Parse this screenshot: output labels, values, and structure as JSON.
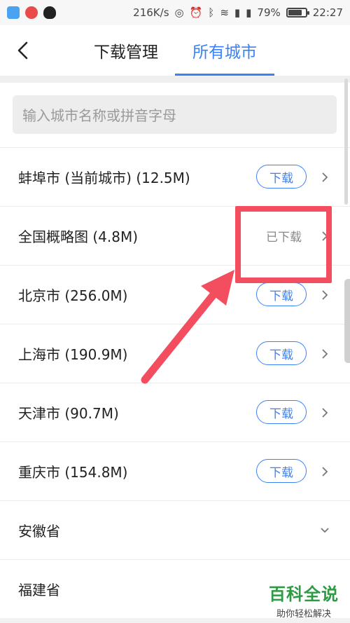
{
  "status_bar": {
    "speed": "216K/s",
    "battery": "79%",
    "battery_level": 0.79,
    "time": "22:27"
  },
  "nav": {
    "tab_download": "下载管理",
    "tab_cities": "所有城市"
  },
  "search": {
    "placeholder": "输入城市名称或拼音字母"
  },
  "list": [
    {
      "name": "蚌埠市 (当前城市) (12.5M)",
      "action": "下载"
    },
    {
      "name": "全国概略图 (4.8M)",
      "action": "已下载"
    },
    {
      "name": "北京市 (256.0M)",
      "action": "下载"
    },
    {
      "name": "上海市 (190.9M)",
      "action": "下载"
    },
    {
      "name": "天津市 (90.7M)",
      "action": "下载"
    },
    {
      "name": "重庆市 (154.8M)",
      "action": "下载"
    },
    {
      "name": "安徽省"
    },
    {
      "name": "福建省"
    }
  ],
  "watermark": {
    "title": "百科全说",
    "subtitle": "助你轻松解决"
  },
  "colors": {
    "accent": "#3b82f6",
    "highlight": "#f24e60",
    "watermark": "#2e9a44"
  }
}
